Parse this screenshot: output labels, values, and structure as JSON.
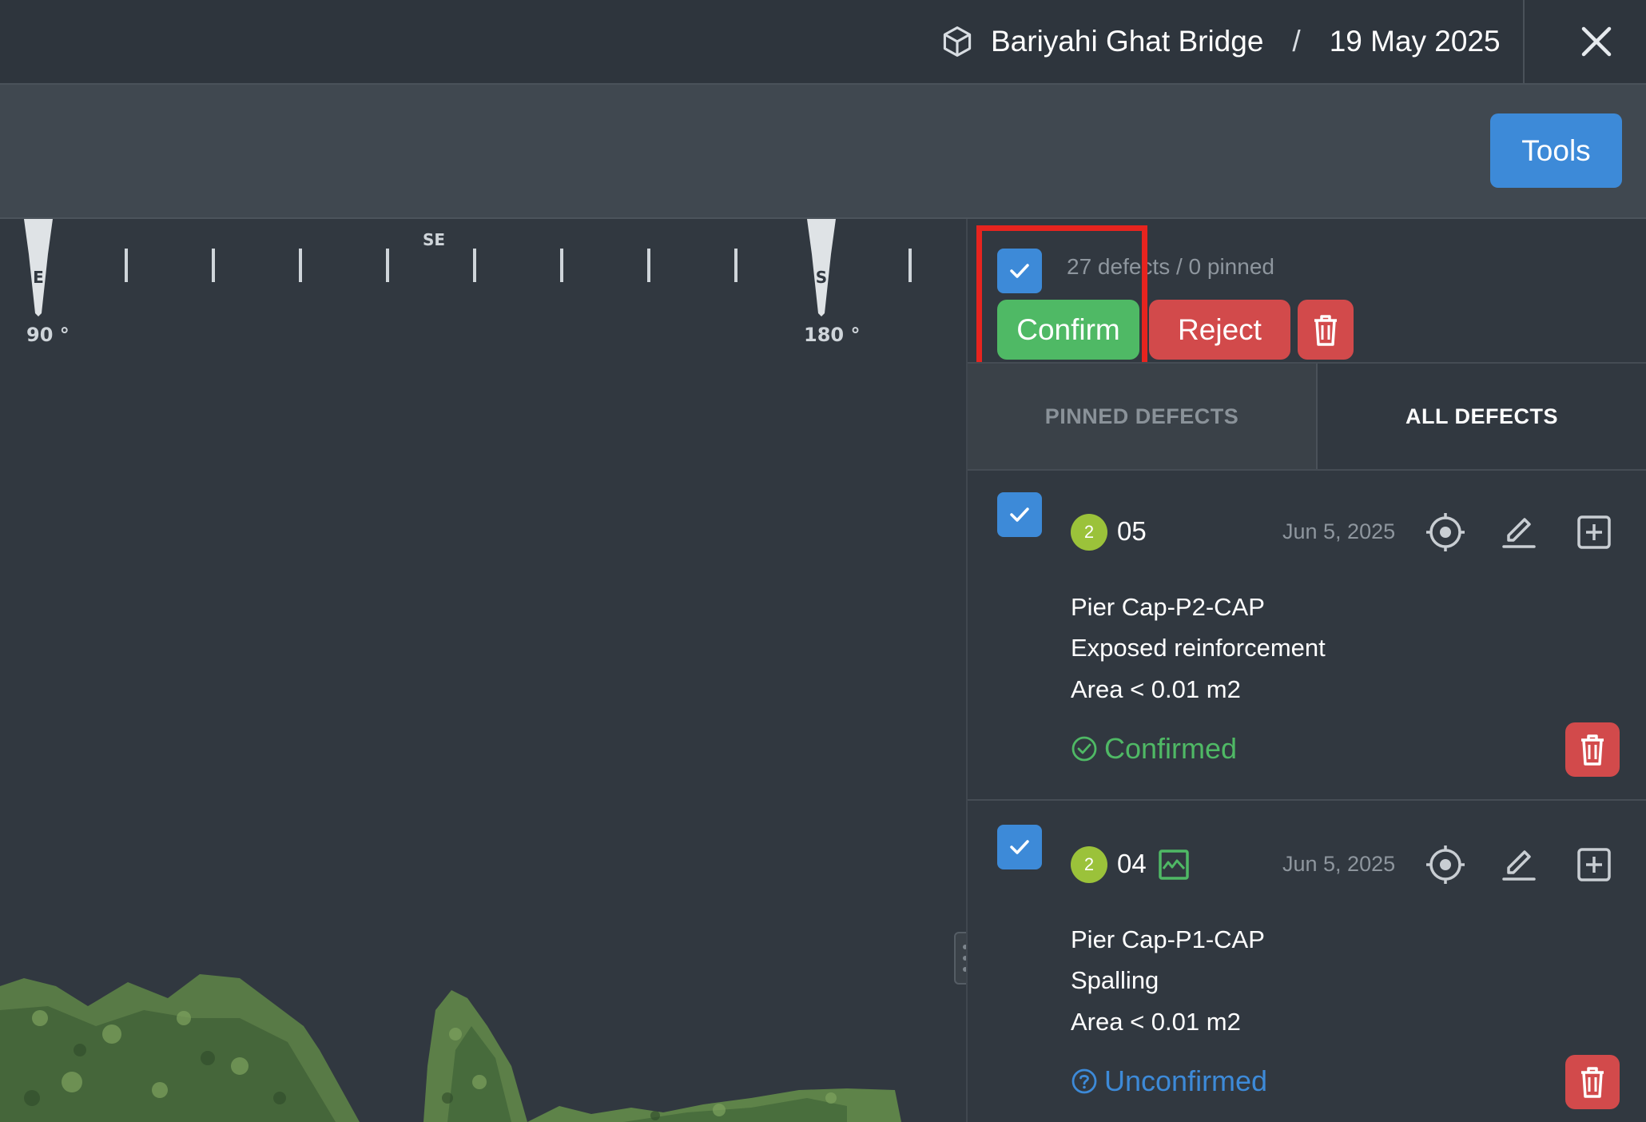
{
  "header": {
    "project": "Bariyahi Ghat Bridge",
    "separator": "/",
    "date": "19 May 2025"
  },
  "toolbar": {
    "tools_label": "Tools"
  },
  "compass": {
    "labels": [
      "E",
      "SE",
      "S"
    ],
    "degrees": [
      "90 °",
      "180 °"
    ]
  },
  "panel": {
    "count_text": "27 defects / 0 pinned",
    "confirm_label": "Confirm",
    "reject_label": "Reject",
    "tabs": [
      "PINNED DEFECTS",
      "ALL DEFECTS"
    ],
    "active_tab": "ALL DEFECTS"
  },
  "defects": [
    {
      "severity": "2",
      "id": "05",
      "date": "Jun 5, 2025",
      "component": "Pier Cap-P2-CAP",
      "type": "Exposed reinforcement",
      "area": "Area < 0.01 m2",
      "status": "Confirmed",
      "checked": true,
      "has_image": false
    },
    {
      "severity": "2",
      "id": "04",
      "date": "Jun 5, 2025",
      "component": "Pier Cap-P1-CAP",
      "type": "Spalling",
      "area": "Area < 0.01 m2",
      "status": "Unconfirmed",
      "checked": true,
      "has_image": true
    }
  ],
  "colors": {
    "accent_blue": "#3d8ad8",
    "confirm_green": "#4fb965",
    "reject_red": "#d24a4b",
    "severity_badge": "#9bc23a",
    "highlight_red": "#e7241f"
  }
}
